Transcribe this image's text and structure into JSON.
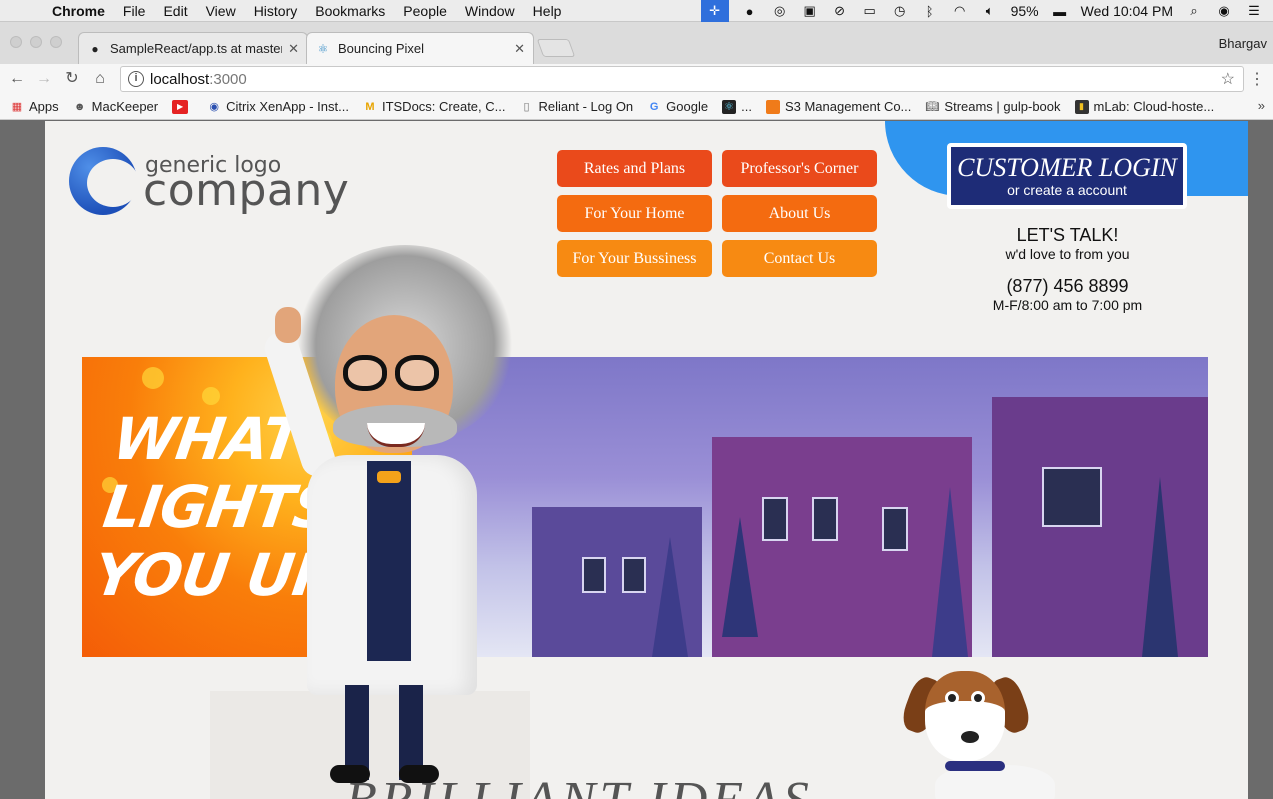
{
  "menubar": {
    "app": "Chrome",
    "items": [
      "File",
      "Edit",
      "View",
      "History",
      "Bookmarks",
      "People",
      "Window",
      "Help"
    ],
    "battery": "95%",
    "clock": "Wed 10:04 PM"
  },
  "browser": {
    "profile": "Bhargav",
    "tabs": [
      {
        "title": "SampleReact/app.ts at master",
        "icon": "github-icon",
        "active": false
      },
      {
        "title": "Bouncing Pixel",
        "icon": "react-icon",
        "active": true
      }
    ],
    "url_host": "localhost",
    "url_port": ":3000",
    "bookmarks": [
      {
        "label": "Apps",
        "icon": "apps-grid-icon"
      },
      {
        "label": "MacKeeper",
        "icon": "mackeeper-icon"
      },
      {
        "label": "",
        "icon": "youtube-icon"
      },
      {
        "label": "Citrix XenApp - Inst...",
        "icon": "citrix-icon"
      },
      {
        "label": "ITSDocs: Create, C...",
        "icon": "itsdocs-icon"
      },
      {
        "label": "Reliant - Log On",
        "icon": "page-icon"
      },
      {
        "label": "Google",
        "icon": "google-icon"
      },
      {
        "label": "...",
        "icon": "react-icon"
      },
      {
        "label": "S3 Management Co...",
        "icon": "aws-icon"
      },
      {
        "label": "Streams | gulp-book",
        "icon": "book-icon"
      },
      {
        "label": "mLab: Cloud-hoste...",
        "icon": "mlab-icon"
      }
    ]
  },
  "site": {
    "logo_top": "generic logo",
    "logo_bottom": "company",
    "nav": [
      "Rates and Plans",
      "Professor's Corner",
      "For Your Home",
      "About Us",
      "For Your Bussiness",
      "Contact Us"
    ],
    "login_title": "CUSTOMER LOGIN",
    "login_sub": "or create a account",
    "talk_title": "LET'S TALK!",
    "talk_sub": "w'd love to from you",
    "phone": "(877) 456 8899",
    "hours": "M-F/8:00 am to 7:00 pm",
    "banner_line1": "WHAT",
    "banner_line2": "LIGHTS",
    "banner_line3": "YOU UP!",
    "bottom_heading": "BRILLIANT IDEAS"
  },
  "colors": {
    "nav_row1": "#ea4a1b",
    "nav_row2": "#f46b10",
    "nav_row3": "#f78a12",
    "login_bg": "#1e2c77",
    "swoosh": "#2f95ef"
  }
}
